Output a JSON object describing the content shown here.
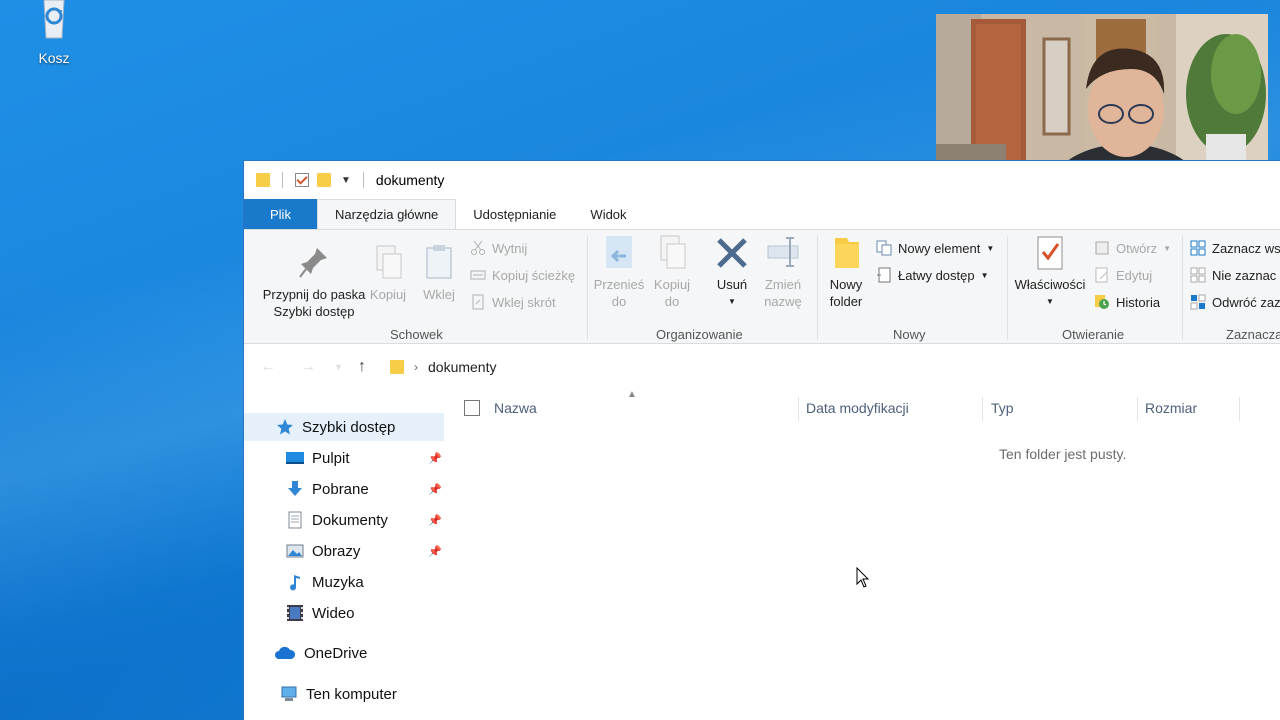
{
  "desktop": {
    "recycle_bin_label": "Kosz"
  },
  "window": {
    "title": "dokumenty",
    "tabs": {
      "file": "Plik",
      "home": "Narzędzia główne",
      "share": "Udostępnianie",
      "view": "Widok"
    }
  },
  "ribbon": {
    "clipboard": {
      "pin_line1": "Przypnij do paska",
      "pin_line2": "Szybki dostęp",
      "copy": "Kopiuj",
      "paste": "Wklej",
      "cut": "Wytnij",
      "copy_path": "Kopiuj ścieżkę",
      "paste_shortcut": "Wklej skrót",
      "group": "Schowek"
    },
    "organize": {
      "move_line1": "Przenieś",
      "move_line2": "do",
      "copy_line1": "Kopiuj",
      "copy_line2": "do",
      "delete": "Usuń",
      "rename_line1": "Zmień",
      "rename_line2": "nazwę",
      "group": "Organizowanie"
    },
    "new": {
      "folder_line1": "Nowy",
      "folder_line2": "folder",
      "new_item": "Nowy element",
      "easy_access": "Łatwy dostęp",
      "group": "Nowy"
    },
    "open": {
      "properties": "Właściwości",
      "open": "Otwórz",
      "edit": "Edytuj",
      "history": "Historia",
      "group": "Otwieranie"
    },
    "select": {
      "select_all": "Zaznacz ws",
      "select_none": "Nie zaznac",
      "invert": "Odwróć zaz",
      "group": "Zaznacza"
    }
  },
  "address": {
    "path_segment": "dokumenty"
  },
  "navpane": {
    "quick_access": "Szybki dostęp",
    "items": [
      {
        "label": "Pulpit"
      },
      {
        "label": "Pobrane"
      },
      {
        "label": "Dokumenty"
      },
      {
        "label": "Obrazy"
      },
      {
        "label": "Muzyka"
      },
      {
        "label": "Wideo"
      }
    ],
    "onedrive": "OneDrive",
    "this_pc": "Ten komputer"
  },
  "content": {
    "columns": {
      "name": "Nazwa",
      "date": "Data modyfikacji",
      "type": "Typ",
      "size": "Rozmiar"
    },
    "empty_message": "Ten folder jest pusty."
  },
  "colors": {
    "accent": "#1979ca",
    "folder": "#f7cd47",
    "selection": "#e5f0fb"
  }
}
